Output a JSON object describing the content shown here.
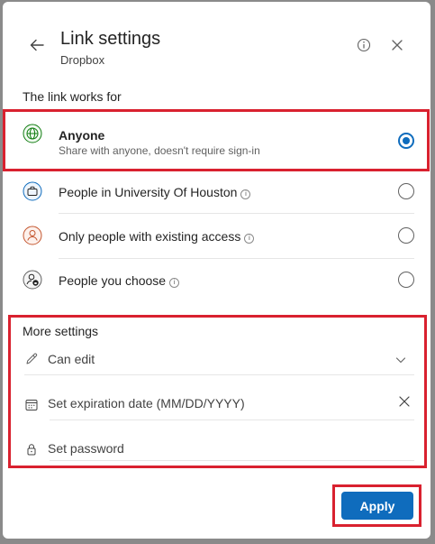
{
  "header": {
    "title": "Link settings",
    "subtitle": "Dropbox"
  },
  "link_works_for": {
    "label": "The link works for",
    "options": [
      {
        "label": "Anyone",
        "sublabel": "Share with anyone, doesn't require sign-in",
        "selected": true,
        "icon": "globe-icon"
      },
      {
        "label": "People in University Of Houston",
        "selected": false,
        "icon": "briefcase-icon"
      },
      {
        "label": "Only people with existing access",
        "selected": false,
        "icon": "person-icon"
      },
      {
        "label": "People you choose",
        "selected": false,
        "icon": "person-lock-icon"
      }
    ]
  },
  "more_settings": {
    "label": "More settings",
    "permission": "Can edit",
    "expiration_placeholder": "Set expiration date (MM/DD/YYYY)",
    "password_placeholder": "Set password"
  },
  "footer": {
    "apply_label": "Apply"
  },
  "colors": {
    "accent": "#0f6cbd",
    "highlight_box": "#d9212f"
  }
}
